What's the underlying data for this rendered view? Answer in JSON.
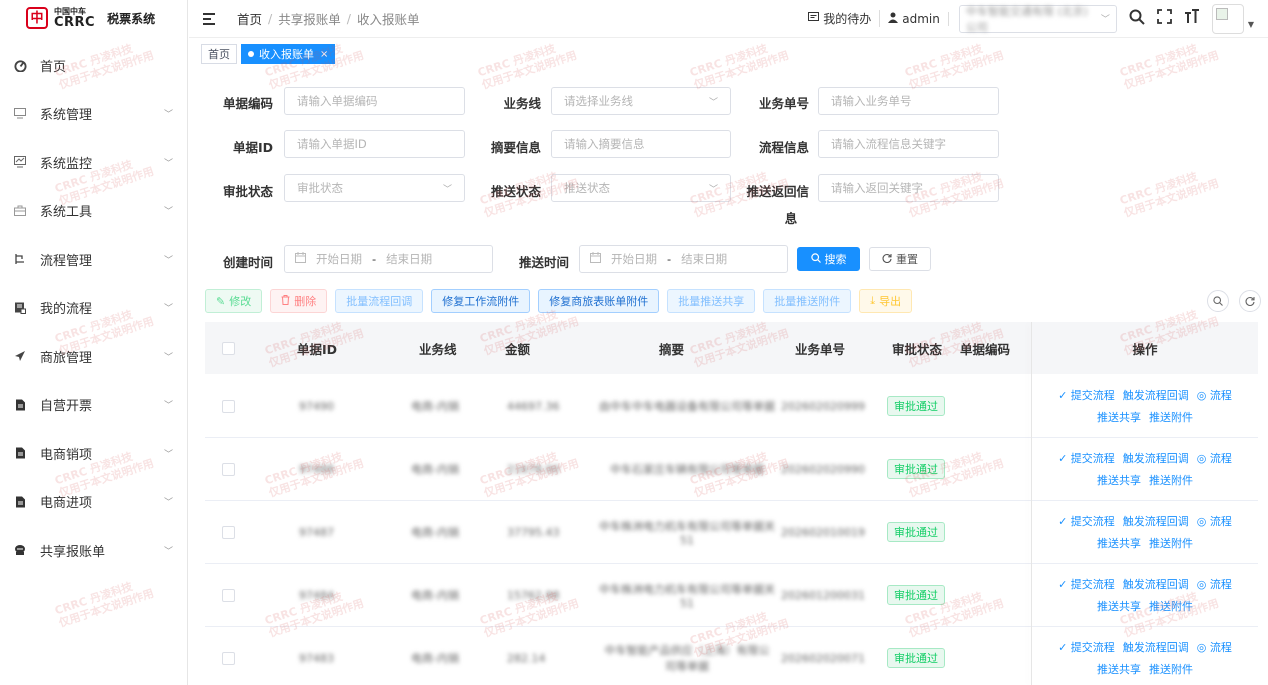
{
  "app": {
    "logo_cn": "中国中车",
    "logo_en": "CRRC",
    "logo_mark": "中",
    "system_name": "税票系统"
  },
  "sidebar": {
    "items": [
      {
        "label": "首页",
        "icon": "dashboard-icon",
        "chevron": false
      },
      {
        "label": "系统管理",
        "icon": "monitor-icon",
        "chevron": true
      },
      {
        "label": "系统监控",
        "icon": "monitor-chart-icon",
        "chevron": true
      },
      {
        "label": "系统工具",
        "icon": "toolbox-icon",
        "chevron": true
      },
      {
        "label": "流程管理",
        "icon": "flow-icon",
        "chevron": true
      },
      {
        "label": "我的流程",
        "icon": "document-icon",
        "chevron": true
      },
      {
        "label": "商旅管理",
        "icon": "send-icon",
        "chevron": true
      },
      {
        "label": "自营开票",
        "icon": "file-icon",
        "chevron": true
      },
      {
        "label": "电商销项",
        "icon": "file-icon",
        "chevron": true
      },
      {
        "label": "电商进项",
        "icon": "file-icon",
        "chevron": true
      },
      {
        "label": "共享报账单",
        "icon": "shared-icon",
        "chevron": true
      }
    ]
  },
  "header": {
    "breadcrumb": [
      "首页",
      "共享报账单",
      "收入报账单"
    ],
    "todo_label": "我的待办",
    "user": "admin",
    "org_value": "中车智能交通有限 (北京) 公司"
  },
  "tags": [
    {
      "label": "首页",
      "active": false
    },
    {
      "label": "收入报账单",
      "active": true,
      "close": "×"
    }
  ],
  "form": {
    "doc_code": {
      "label": "单据编码",
      "placeholder": "请输入单据编码"
    },
    "business_line": {
      "label": "业务线",
      "placeholder": "请选择业务线"
    },
    "business_no": {
      "label": "业务单号",
      "placeholder": "请输入业务单号"
    },
    "doc_id": {
      "label": "单据ID",
      "placeholder": "请输入单据ID"
    },
    "summary": {
      "label": "摘要信息",
      "placeholder": "请输入摘要信息"
    },
    "flow_info": {
      "label": "流程信息",
      "placeholder": "请输入流程信息关键字"
    },
    "approval_status": {
      "label": "审批状态",
      "placeholder": "审批状态"
    },
    "push_status": {
      "label": "推送状态",
      "placeholder": "推送状态"
    },
    "push_return": {
      "label_1": "推送返回信",
      "label_2": "息",
      "placeholder": "请输入返回关键字"
    },
    "create_time": {
      "label": "创建时间",
      "start": "开始日期",
      "end": "结束日期",
      "dash": "-"
    },
    "push_time": {
      "label": "推送时间",
      "start": "开始日期",
      "end": "结束日期",
      "dash": "-"
    },
    "search_label": "搜索",
    "reset_label": "重置"
  },
  "toolbar": {
    "edit": "修改",
    "delete": "删除",
    "batch_flow_callback": "批量流程回调",
    "fix_workflow_attachment": "修复工作流附件",
    "fix_travel_attachment": "修复商旅表账单附件",
    "batch_push_share": "批量推送共享",
    "batch_push_attachment": "批量推送附件",
    "export": "导出"
  },
  "table": {
    "columns": {
      "doc_id": "单据ID",
      "business_line": "业务线",
      "amount": "金额",
      "summary": "摘要",
      "business_no": "业务单号",
      "approval_status": "审批状态",
      "doc_code": "单据编码",
      "ops": "操作"
    },
    "rows": [
      {
        "doc_id": "97490",
        "business_line": "电商-内销",
        "amount": "44697.36",
        "summary": "由中车中车电器设备有限公司等单据",
        "summary_2": "",
        "business_no": "202602020999",
        "status": "审批通过"
      },
      {
        "doc_id": "97488",
        "business_line": "电商-内销",
        "amount": "21678.00",
        "summary": "中车石家庄车辆有限公司等单据",
        "summary_2": "",
        "business_no": "202602020990",
        "status": "审批通过"
      },
      {
        "doc_id": "97487",
        "business_line": "电商-内销",
        "amount": "37795.43",
        "summary": "中车株洲电力机车有限公司等单据关",
        "summary_2": "51",
        "business_no": "202602010019",
        "status": "审批通过"
      },
      {
        "doc_id": "97484",
        "business_line": "电商-内销",
        "amount": "15762.88",
        "summary": "中车株洲电力机车有限公司等单据关",
        "summary_2": "51",
        "business_no": "202601200031",
        "status": "审批通过"
      },
      {
        "doc_id": "97483",
        "business_line": "电商-内销",
        "amount": "282.14",
        "summary": "中车智能产品供应（上海）有限公",
        "summary_2": "司等单据",
        "business_no": "202602020071",
        "status": "审批通过"
      }
    ],
    "row_ops": {
      "submit_flow": "提交流程",
      "trigger_callback": "触发流程回调",
      "flow": "流程",
      "push_share": "推送共享",
      "push_attachment": "推送附件"
    }
  },
  "watermark": {
    "line1": "CRRC 丹凌科技",
    "line2": "仅用于本文说明作用"
  },
  "colors": {
    "primary": "#1890ff",
    "success": "#13ce66",
    "danger": "#ff4d4f",
    "warning": "#ffba00",
    "brand_red": "#d9001b"
  }
}
